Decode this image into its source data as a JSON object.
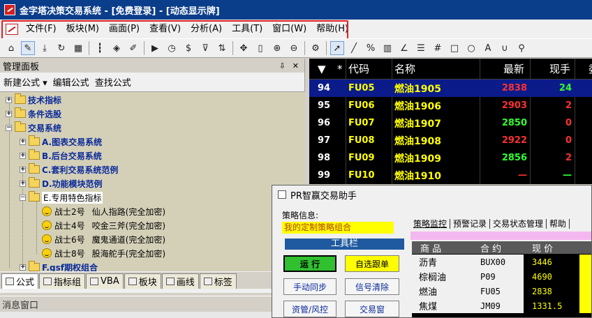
{
  "window": {
    "title": "金字塔决策交易系统 - [免费登录] - [动态显示牌]"
  },
  "menu": {
    "items": [
      "文件(F)",
      "板块(M)",
      "画面(P)",
      "查看(V)",
      "分析(A)",
      "工具(T)",
      "窗口(W)",
      "帮助(H)"
    ]
  },
  "toolbar": {
    "icons": [
      "home-icon",
      "pen-icon",
      "download-icon",
      "refresh-icon",
      "grid-icon",
      "candles-icon",
      "alert-icon",
      "edit-icon",
      "play-icon",
      "clock-icon",
      "dollar-icon",
      "filter-icon",
      "sort-icon",
      "move-icon",
      "ruler-icon",
      "zoom-in-icon",
      "zoom-out-icon",
      "settings-icon",
      "cursor-icon",
      "line-icon",
      "percent-icon",
      "bars-icon",
      "angle-icon",
      "hlines-icon",
      "hash-icon",
      "rect-icon",
      "ellipse-icon",
      "text-icon",
      "magnet-icon",
      "pin-icon"
    ]
  },
  "panel": {
    "title": "管理面板",
    "commands": [
      "新建公式 ▾",
      "编辑公式",
      "查找公式"
    ],
    "tree": [
      {
        "label": "技术指标",
        "level": 0,
        "expander": "+"
      },
      {
        "label": "条件选股",
        "level": 0,
        "expander": "+"
      },
      {
        "label": "交易系统",
        "level": 0,
        "expander": "-"
      },
      {
        "label": "A.图表交易系统",
        "level": 1,
        "expander": "+"
      },
      {
        "label": "B.后台交易系统",
        "level": 1,
        "expander": "+"
      },
      {
        "label": "C.套利交易系统范例",
        "level": 1,
        "expander": "+"
      },
      {
        "label": "D.功能模块范例",
        "level": 1,
        "expander": "+"
      },
      {
        "label": "E.专用特色指标",
        "level": 1,
        "expander": "-"
      },
      {
        "label": "战士2号",
        "desc": "仙人指路(完全加密)",
        "level": 2
      },
      {
        "label": "战士4号",
        "desc": "咬金三斧(完全加密)",
        "level": 2
      },
      {
        "label": "战士6号",
        "desc": "魔鬼通道(完全加密)",
        "level": 2
      },
      {
        "label": "战士8号",
        "desc": "股海舵手(完全加密)",
        "level": 2
      },
      {
        "label": "F.gsf期权组合",
        "level": 1,
        "expander": "+"
      }
    ],
    "tabs": [
      "公式",
      "指标组",
      "VBA",
      "板块",
      "画线",
      "标签"
    ]
  },
  "message_window": {
    "title": "消息窗口"
  },
  "quotes": {
    "headers": [
      "▼",
      "*",
      "代码",
      "名称",
      "最新",
      "现手",
      "委"
    ],
    "rows": [
      {
        "idx": "94",
        "code": "FU05",
        "name": "燃油1905",
        "last": "2838",
        "vol": "24",
        "last_color": "#ff3030",
        "vol_color": "#30ff30"
      },
      {
        "idx": "95",
        "code": "FU06",
        "name": "燃油1906",
        "last": "2903",
        "vol": "2",
        "last_color": "#ff3030",
        "vol_color": "#ff3030"
      },
      {
        "idx": "96",
        "code": "FU07",
        "name": "燃油1907",
        "last": "2850",
        "vol": "0",
        "last_color": "#30ff30",
        "vol_color": "#ff3030"
      },
      {
        "idx": "97",
        "code": "FU08",
        "name": "燃油1908",
        "last": "2922",
        "vol": "0",
        "last_color": "#ff3030",
        "vol_color": "#ff3030"
      },
      {
        "idx": "98",
        "code": "FU09",
        "name": "燃油1909",
        "last": "2856",
        "vol": "2",
        "last_color": "#30ff30",
        "vol_color": "#ff3030"
      },
      {
        "idx": "99",
        "code": "FU10",
        "name": "燃油1910",
        "last": "—",
        "vol": "—",
        "last_color": "#ff3030",
        "vol_color": "#30ff30"
      }
    ]
  },
  "assistant": {
    "title": "PR智赢交易助手",
    "strategy_label": "策略信息:",
    "strategy_value": "我的定制策略组合",
    "toolbar_label": "工具栏",
    "buttons": {
      "run": "运 行",
      "follow": "自选跟单",
      "sync": "手动同步",
      "clear": "信号清除",
      "funds": "资管/风控",
      "trade": "交易窗"
    },
    "tabs": [
      "策略监控",
      "预警记录",
      "交易状态管理",
      "帮助"
    ],
    "table": {
      "headers": [
        "商 品",
        "合 约",
        "现 价"
      ],
      "rows": [
        {
          "name": "沥青",
          "contract": "BUX00",
          "price": "3446"
        },
        {
          "name": "棕榈油",
          "contract": "P09",
          "price": "4690"
        },
        {
          "name": "燃油",
          "contract": "FU05",
          "price": "2838"
        },
        {
          "name": "焦煤",
          "contract": "JM09",
          "price": "1331.5"
        }
      ]
    }
  }
}
